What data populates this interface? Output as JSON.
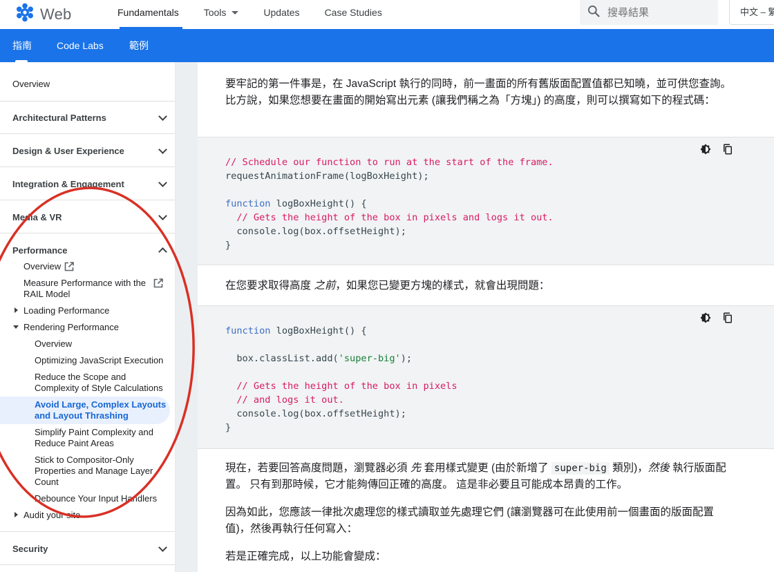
{
  "header": {
    "logo_text": "Web",
    "nav": [
      {
        "label": "Fundamentals",
        "active": true
      },
      {
        "label": "Tools",
        "dropdown": true
      },
      {
        "label": "Updates"
      },
      {
        "label": "Case Studies"
      }
    ],
    "search_placeholder": "搜尋結果",
    "language": "中文 – 繁"
  },
  "subnav": {
    "tabs": [
      "指南",
      "Code Labs",
      "範例"
    ]
  },
  "sidebar": {
    "overview": "Overview",
    "sections": [
      "Architectural Patterns",
      "Design & User Experience",
      "Integration & Engagement",
      "Media & VR",
      "Performance",
      "Security"
    ],
    "performance": {
      "overview": "Overview",
      "rail_line1": "Measure Performance with the",
      "rail_line2": "RAIL Model",
      "loading": "Loading Performance",
      "rendering": "Rendering Performance",
      "rendering_items": [
        "Overview",
        "Optimizing JavaScript Execution",
        "Reduce the Scope and",
        "Complexity of Style Calculations",
        "Avoid Large, Complex Layouts",
        "and Layout Thrashing",
        "Simplify Paint Complexity and",
        "Reduce Paint Areas",
        "Stick to Compositor-Only",
        "Properties and Manage Layer",
        "Count",
        "Debounce Your Input Handlers"
      ],
      "audit": "Audit your site"
    }
  },
  "content": {
    "p1": "要牢記的第一件事是，在 JavaScript 執行的同時，前一畫面的所有舊版面配置值都已知曉，並可供您查詢。 比方說，如果您想要在畫面的開始寫出元素 (讓我們稱之為「方塊」) 的高度，則可以撰寫如下的程式碼：",
    "code1": {
      "l1": "// Schedule our function to run at the start of the frame.",
      "l2": "requestAnimationFrame(logBoxHeight);",
      "l3_kw": "function",
      "l3_rest": " logBoxHeight() {",
      "l4": "  // Gets the height of the box in pixels and logs it out.",
      "l5": "  console.log(box.offsetHeight);",
      "l6": "}"
    },
    "p2_a": "在您要求取得高度 ",
    "p2_em": "之前",
    "p2_b": "，如果您已變更方塊的樣式，就會出現問題：",
    "code2": {
      "l1_kw": "function",
      "l1_rest": " logBoxHeight() {",
      "l2_a": "  box.classList.add(",
      "l2_str": "'super-big'",
      "l2_b": ");",
      "l3": "  // Gets the height of the box in pixels",
      "l4": "  // and logs it out.",
      "l5": "  console.log(box.offsetHeight);",
      "l6": "}"
    },
    "p3_a": "現在，若要回答高度問題，瀏覽器必須 ",
    "p3_em1": "先",
    "p3_b": " 套用樣式變更 (由於新增了 ",
    "p3_code": "super-big",
    "p3_c": " 類別)，",
    "p3_em2": "然後",
    "p3_d": " 執行版面配置。 只有到那時候，它才能夠傳回正確的高度。 這是非必要且可能成本昂貴的工作。",
    "p4": "因為如此，您應該一律批次處理您的樣式讀取並先處理它們 (讓瀏覽器可在此使用前一個畫面的版面配置值)，然後再執行任何寫入：",
    "p5": "若是正確完成，以上功能會變成："
  },
  "colors": {
    "brand_blue": "#1a73e8",
    "annotation_red": "#d93025",
    "comment": "#d81b60",
    "keyword": "#3f6ec6",
    "string": "#188038"
  },
  "icons": [
    "logo-icon",
    "search-icon",
    "chevron-down-icon",
    "external-link-icon",
    "theme-toggle-icon",
    "copy-icon"
  ]
}
